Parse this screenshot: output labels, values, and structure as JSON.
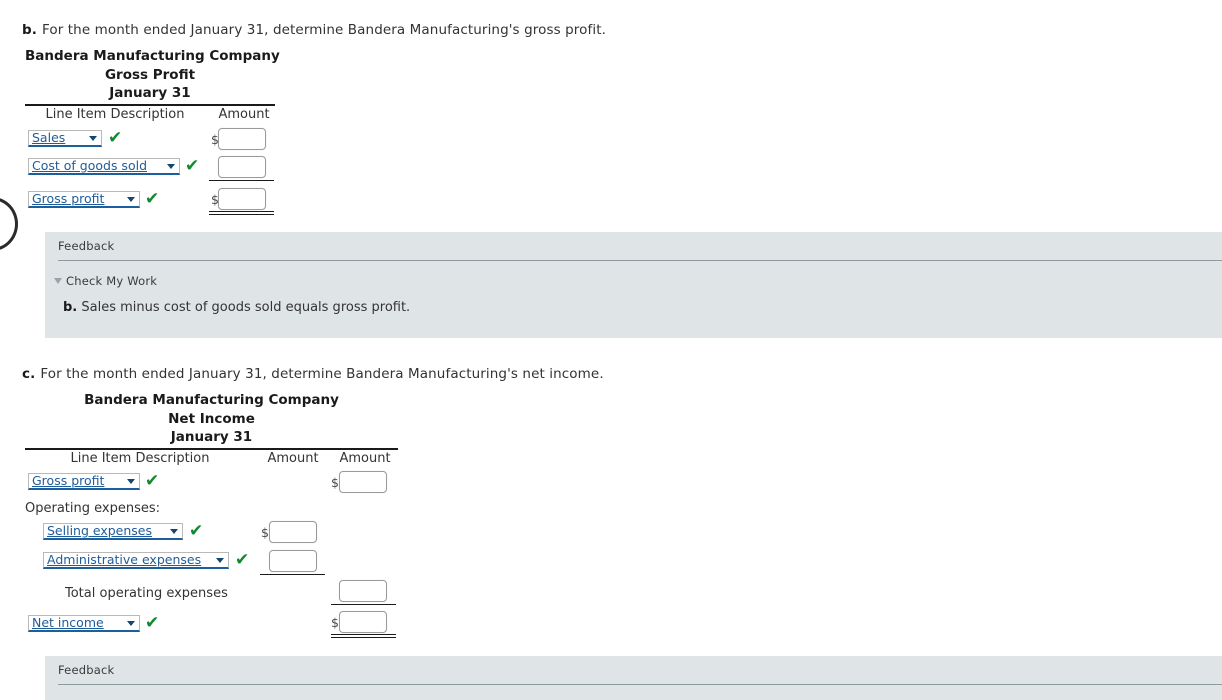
{
  "colors": {
    "accent_link": "#1f5c99",
    "check_green": "#0f8a2e",
    "feedback_bg": "#dfe5e7",
    "rule": "#1a1a1a"
  },
  "question_b": {
    "letter": "b.",
    "text": "For the month ended January 31, determine Bandera Manufacturing's gross profit.",
    "statement": {
      "company": "Bandera Manufacturing Company",
      "report": "Gross Profit",
      "period": "January 31",
      "columns": [
        "Line Item Description",
        "Amount"
      ],
      "rows": [
        {
          "select_value": "Sales",
          "checked": true,
          "dollar": "$",
          "amount": ""
        },
        {
          "select_value": "Cost of goods sold",
          "checked": true,
          "dollar": "",
          "amount": ""
        },
        {
          "select_value": "Gross profit",
          "checked": true,
          "dollar": "$",
          "amount": ""
        }
      ]
    },
    "feedback": {
      "title": "Feedback",
      "toggle": "Check My Work",
      "body_label": "b.",
      "body_text": "Sales minus cost of goods sold equals gross profit."
    }
  },
  "question_c": {
    "letter": "c.",
    "text": "For the month ended January 31, determine Bandera Manufacturing's net income.",
    "statement": {
      "company": "Bandera Manufacturing Company",
      "report": "Net Income",
      "period": "January 31",
      "columns": [
        "Line Item Description",
        "Amount",
        "Amount"
      ],
      "rows": [
        {
          "type": "select",
          "select_value": "Gross profit",
          "checked": true,
          "col": "amount2",
          "dollar": "$",
          "amount": ""
        },
        {
          "type": "label",
          "label": "Operating expenses:"
        },
        {
          "type": "select",
          "select_value": "Selling expenses",
          "checked": true,
          "col": "amount1",
          "dollar": "$",
          "amount": ""
        },
        {
          "type": "select",
          "select_value": "Administrative expenses",
          "checked": true,
          "col": "amount1",
          "dollar": "",
          "amount": ""
        },
        {
          "type": "label-total",
          "label": "Total operating expenses",
          "col": "amount2",
          "dollar": "",
          "amount": ""
        },
        {
          "type": "select",
          "select_value": "Net income",
          "checked": true,
          "col": "amount2",
          "dollar": "$",
          "amount": ""
        }
      ]
    },
    "feedback": {
      "title": "Feedback"
    }
  },
  "icons": {
    "check": "✔",
    "caret_down": "▼"
  }
}
